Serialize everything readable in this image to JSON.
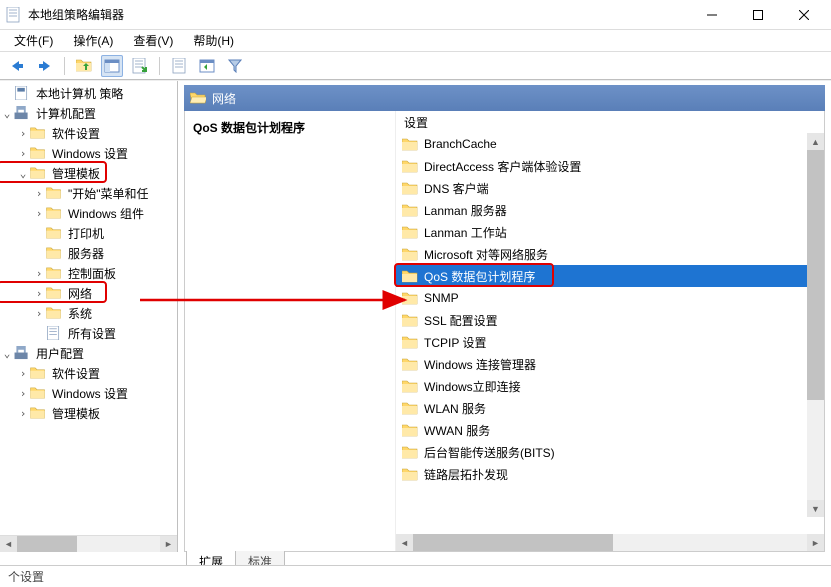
{
  "window": {
    "title": "本地组策略编辑器"
  },
  "menus": {
    "file": "文件(F)",
    "action": "操作(A)",
    "view": "查看(V)",
    "help": "帮助(H)"
  },
  "tree": [
    {
      "depth": 0,
      "twisty": "",
      "icon": "policy",
      "label": "本地计算机 策略",
      "id": "root"
    },
    {
      "depth": 0,
      "twisty": "v",
      "icon": "config",
      "label": "计算机配置",
      "id": "computer-cfg"
    },
    {
      "depth": 1,
      "twisty": ">",
      "icon": "folder",
      "label": "软件设置",
      "id": "sw-settings"
    },
    {
      "depth": 1,
      "twisty": ">",
      "icon": "folder",
      "label": "Windows 设置",
      "id": "win-settings"
    },
    {
      "depth": 1,
      "twisty": "v",
      "icon": "folder",
      "label": "管理模板",
      "id": "admin-tmpl",
      "red": true
    },
    {
      "depth": 2,
      "twisty": ">",
      "icon": "folder",
      "label": "\"开始\"菜单和任",
      "id": "start-menu"
    },
    {
      "depth": 2,
      "twisty": ">",
      "icon": "folder",
      "label": "Windows 组件",
      "id": "win-comp"
    },
    {
      "depth": 2,
      "twisty": "",
      "icon": "folder",
      "label": "打印机",
      "id": "printers"
    },
    {
      "depth": 2,
      "twisty": "",
      "icon": "folder",
      "label": "服务器",
      "id": "servers"
    },
    {
      "depth": 2,
      "twisty": ">",
      "icon": "folder",
      "label": "控制面板",
      "id": "ctrlpanel"
    },
    {
      "depth": 2,
      "twisty": ">",
      "icon": "folder",
      "label": "网络",
      "id": "network",
      "red": true
    },
    {
      "depth": 2,
      "twisty": ">",
      "icon": "folder",
      "label": "系统",
      "id": "system"
    },
    {
      "depth": 2,
      "twisty": "",
      "icon": "sheet",
      "label": "所有设置",
      "id": "all-settings"
    },
    {
      "depth": 0,
      "twisty": "v",
      "icon": "config",
      "label": "用户配置",
      "id": "user-cfg"
    },
    {
      "depth": 1,
      "twisty": ">",
      "icon": "folder",
      "label": "软件设置",
      "id": "u-sw"
    },
    {
      "depth": 1,
      "twisty": ">",
      "icon": "folder",
      "label": "Windows 设置",
      "id": "u-win"
    },
    {
      "depth": 1,
      "twisty": ">",
      "icon": "folder",
      "label": "管理模板",
      "id": "u-admin"
    }
  ],
  "location": {
    "label": "网络"
  },
  "detail": {
    "heading": "QoS 数据包计划程序",
    "column": "设置",
    "items": [
      {
        "label": "BranchCache",
        "id": "branchcache"
      },
      {
        "label": "DirectAccess 客户端体验设置",
        "id": "directaccess"
      },
      {
        "label": "DNS 客户端",
        "id": "dns"
      },
      {
        "label": "Lanman 服务器",
        "id": "lanman-srv"
      },
      {
        "label": "Lanman 工作站",
        "id": "lanman-ws"
      },
      {
        "label": "Microsoft 对等网络服务",
        "id": "p2p"
      },
      {
        "label": "QoS 数据包计划程序",
        "id": "qos",
        "selected": true,
        "red": true
      },
      {
        "label": "SNMP",
        "id": "snmp"
      },
      {
        "label": "SSL 配置设置",
        "id": "ssl"
      },
      {
        "label": "TCPIP 设置",
        "id": "tcpip"
      },
      {
        "label": "Windows 连接管理器",
        "id": "wincm"
      },
      {
        "label": "Windows立即连接",
        "id": "wcn"
      },
      {
        "label": "WLAN 服务",
        "id": "wlan"
      },
      {
        "label": "WWAN 服务",
        "id": "wwan"
      },
      {
        "label": "后台智能传送服务(BITS)",
        "id": "bits"
      },
      {
        "label": "链路层拓扑发现",
        "id": "lltd"
      }
    ]
  },
  "tabs": {
    "extended": "扩展",
    "standard": "标准"
  },
  "status": "个设置"
}
